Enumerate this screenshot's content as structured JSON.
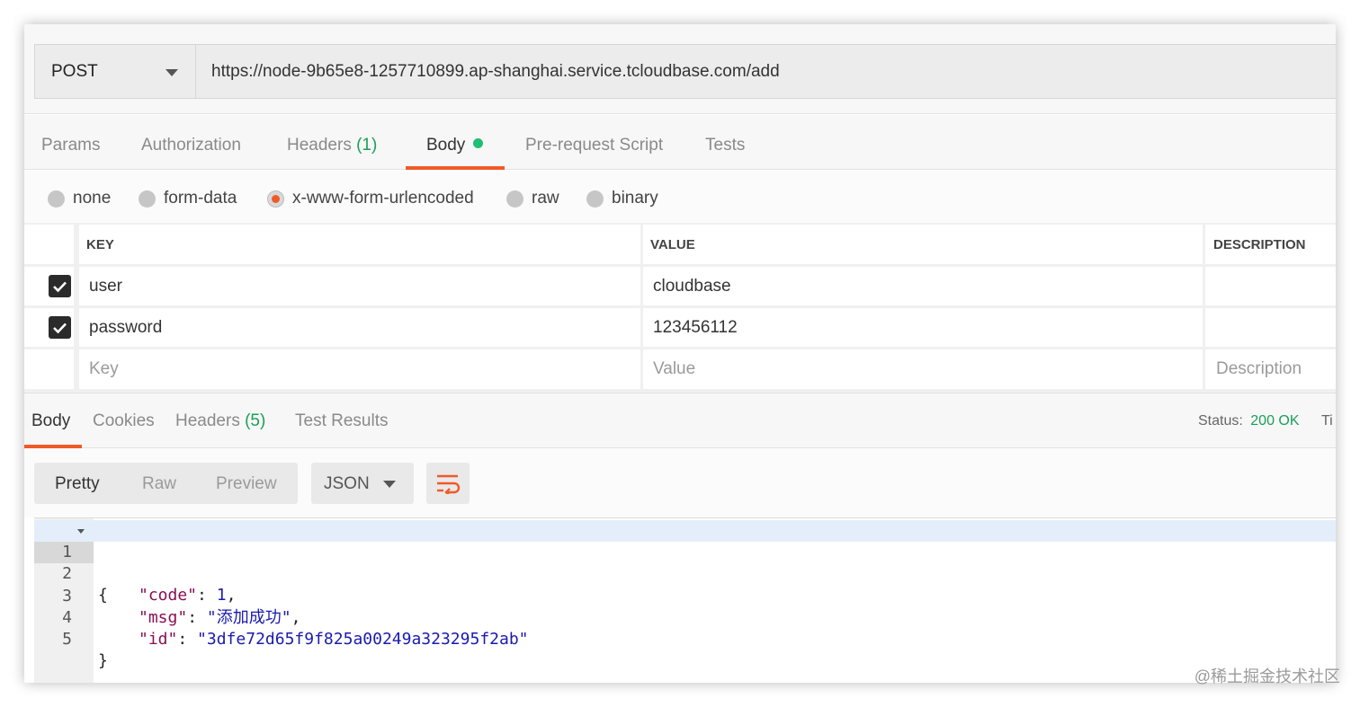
{
  "request": {
    "method": "POST",
    "url": "https://node-9b65e8-1257710899.ap-shanghai.service.tcloudbase.com/add"
  },
  "request_tabs": [
    {
      "label": "Params"
    },
    {
      "label": "Authorization"
    },
    {
      "label": "Headers",
      "count": "(1)"
    },
    {
      "label": "Body"
    },
    {
      "label": "Pre-request Script"
    },
    {
      "label": "Tests"
    }
  ],
  "body_types": [
    "none",
    "form-data",
    "x-www-form-urlencoded",
    "raw",
    "binary"
  ],
  "selected_body_type": "x-www-form-urlencoded",
  "kv_table": {
    "headers": {
      "key": "KEY",
      "value": "VALUE",
      "description": "DESCRIPTION"
    },
    "rows": [
      {
        "checked": true,
        "key": "user",
        "value": "cloudbase",
        "description": ""
      },
      {
        "checked": true,
        "key": "password",
        "value": "123456112",
        "description": ""
      }
    ],
    "placeholder": {
      "key": "Key",
      "value": "Value",
      "description": "Description"
    }
  },
  "response": {
    "tabs": [
      {
        "label": "Body"
      },
      {
        "label": "Cookies"
      },
      {
        "label": "Headers",
        "count": "(5)"
      },
      {
        "label": "Test Results"
      }
    ],
    "status_label": "Status:",
    "status_value": "200 OK",
    "cut_label": "Ti",
    "view_modes": [
      "Pretty",
      "Raw",
      "Preview"
    ],
    "format": "JSON",
    "line_numbers": [
      "1",
      "2",
      "3",
      "4",
      "5"
    ],
    "json": {
      "open": "{",
      "close": "}",
      "fields": [
        {
          "key": "\"code\"",
          "value": "1",
          "suffix": ","
        },
        {
          "key": "\"msg\"",
          "value": "\"添加成功\"",
          "suffix": ","
        },
        {
          "key": "\"id\"",
          "value": "\"3dfe72d65f9f825a00249a323295f2ab\"",
          "suffix": ""
        }
      ]
    }
  },
  "watermark": "@稀土掘金技术社区",
  "colors": {
    "accent": "#f05a28",
    "success": "#1a9f58",
    "json_key": "#8a0f54",
    "json_value": "#1a1ab0"
  }
}
